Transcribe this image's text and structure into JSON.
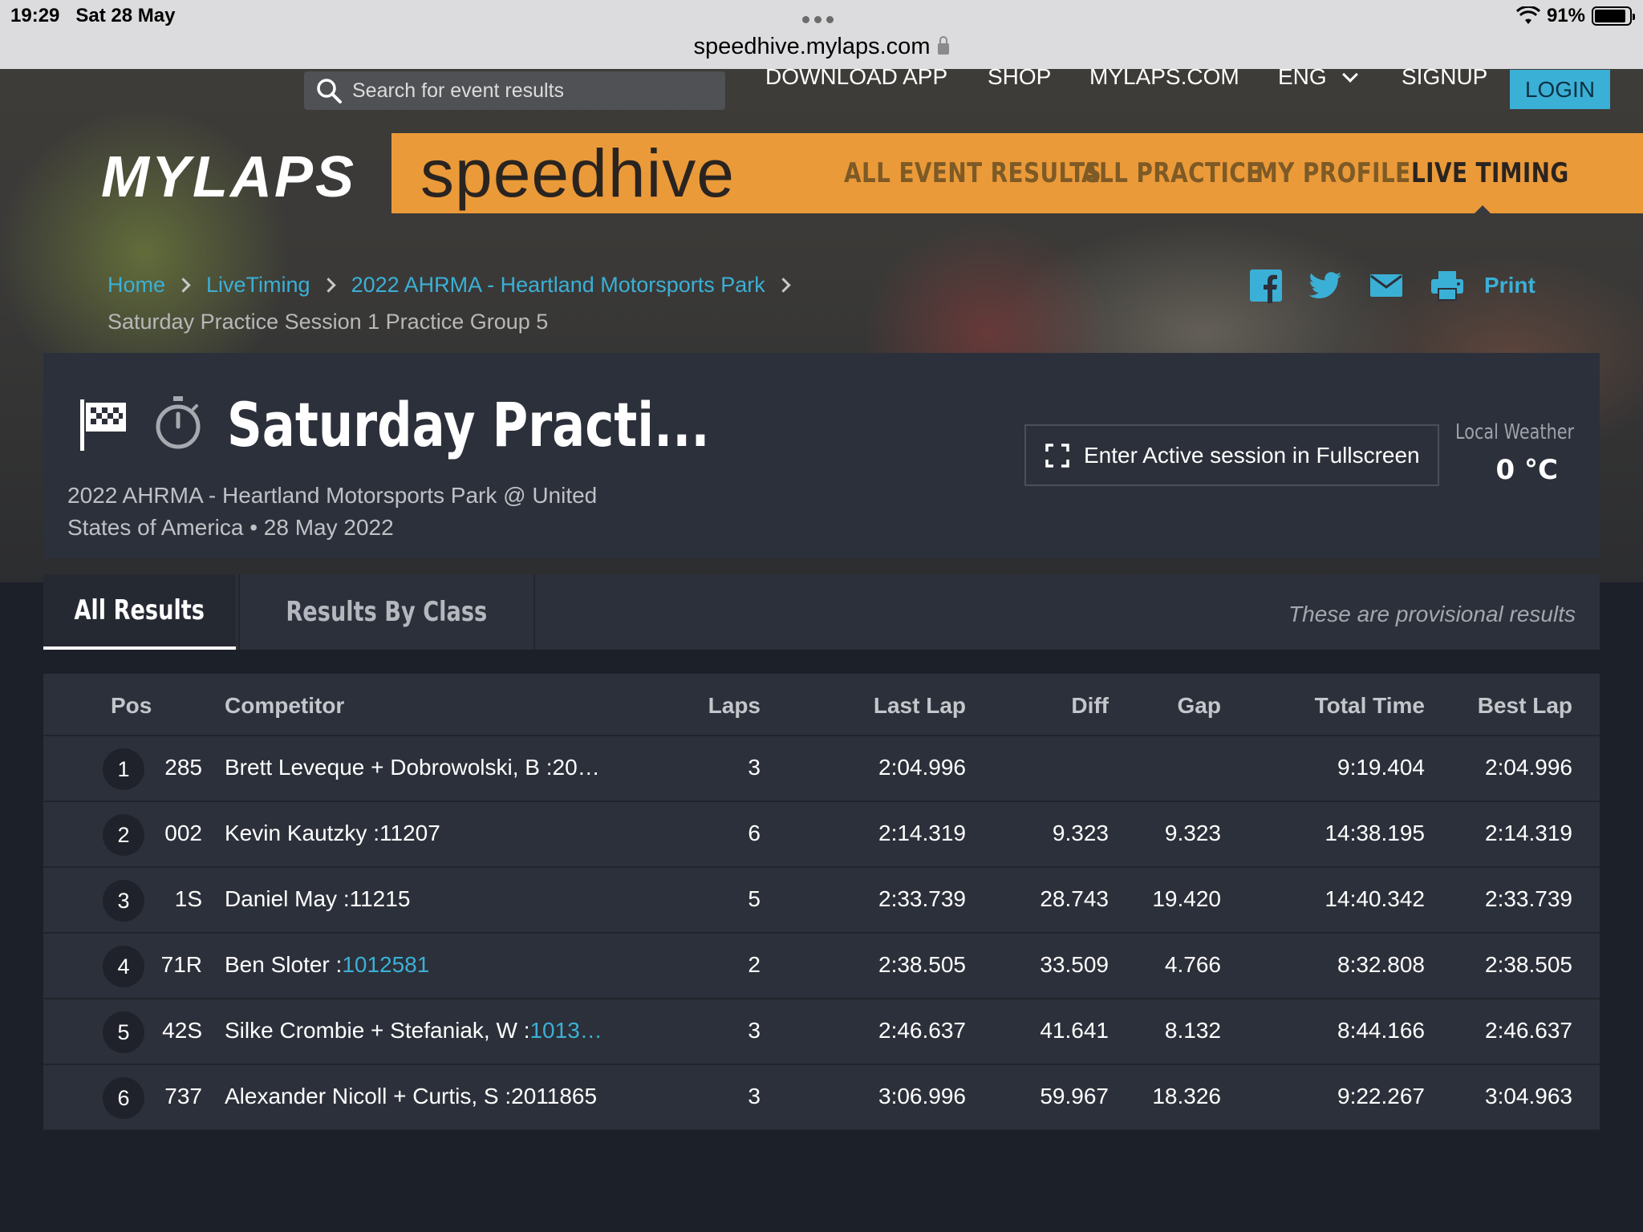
{
  "status_bar": {
    "time": "19:29",
    "date": "Sat 28 May",
    "battery": "91%",
    "battery_level": 0.91
  },
  "browser": {
    "url": "speedhive.mylaps.com"
  },
  "top_nav": {
    "search_placeholder": "Search for event results",
    "download_app": "DOWNLOAD APP",
    "shop": "SHOP",
    "mylaps_com": "MYLAPS.COM",
    "language": "ENG",
    "signup": "SIGNUP",
    "login": "LOGIN"
  },
  "brand": {
    "mylaps": "MYLAPS",
    "speedhive": "speedhive",
    "nav": [
      "ALL EVENT RESULTS",
      "ALL PRACTICE",
      "MY PROFILE",
      "LIVE TIMING"
    ],
    "accent": "#eb9a39"
  },
  "breadcrumb": {
    "items": [
      "Home",
      "LiveTiming",
      "2022 AHRMA - Heartland Motorsports Park"
    ],
    "current": "Saturday Practice Session 1 Practice Group 5"
  },
  "share": {
    "print": "Print"
  },
  "session": {
    "title": "Saturday Practi...",
    "subtitle": "2022 AHRMA - Heartland Motorsports Park @ United States of America • 28 May 2022",
    "fullscreen_button": "Enter Active session in Fullscreen",
    "weather_label": "Local Weather",
    "weather_value": "0 °C"
  },
  "tabs": {
    "all": "All Results",
    "by_class": "Results By Class",
    "note": "These are provisional results"
  },
  "table": {
    "headers": {
      "pos": "Pos",
      "competitor": "Competitor",
      "laps": "Laps",
      "last_lap": "Last Lap",
      "diff": "Diff",
      "gap": "Gap",
      "total_time": "Total Time",
      "best_lap": "Best Lap"
    },
    "rows": [
      {
        "pos": "1",
        "num": "285",
        "name": "Brett Leveque + Dobrowolski, B :20…",
        "name_link": "",
        "laps": "3",
        "last_lap": "2:04.996",
        "diff": "",
        "gap": "",
        "total": "9:19.404",
        "best": "2:04.996"
      },
      {
        "pos": "2",
        "num": "002",
        "name": "Kevin Kautzky :11207",
        "name_link": "",
        "laps": "6",
        "last_lap": "2:14.319",
        "diff": "9.323",
        "gap": "9.323",
        "total": "14:38.195",
        "best": "2:14.319"
      },
      {
        "pos": "3",
        "num": "1S",
        "name": "Daniel May :11215",
        "name_link": "",
        "laps": "5",
        "last_lap": "2:33.739",
        "diff": "28.743",
        "gap": "19.420",
        "total": "14:40.342",
        "best": "2:33.739"
      },
      {
        "pos": "4",
        "num": "71R",
        "name": "Ben Sloter :",
        "name_link": "1012581",
        "laps": "2",
        "last_lap": "2:38.505",
        "diff": "33.509",
        "gap": "4.766",
        "total": "8:32.808",
        "best": "2:38.505"
      },
      {
        "pos": "5",
        "num": "42S",
        "name": "Silke Crombie + Stefaniak, W :",
        "name_link": "1013…",
        "laps": "3",
        "last_lap": "2:46.637",
        "diff": "41.641",
        "gap": "8.132",
        "total": "8:44.166",
        "best": "2:46.637"
      },
      {
        "pos": "6",
        "num": "737",
        "name": "Alexander Nicoll + Curtis, S :2011865",
        "name_link": "",
        "laps": "3",
        "last_lap": "3:06.996",
        "diff": "59.967",
        "gap": "18.326",
        "total": "9:22.267",
        "best": "3:04.963"
      }
    ]
  }
}
